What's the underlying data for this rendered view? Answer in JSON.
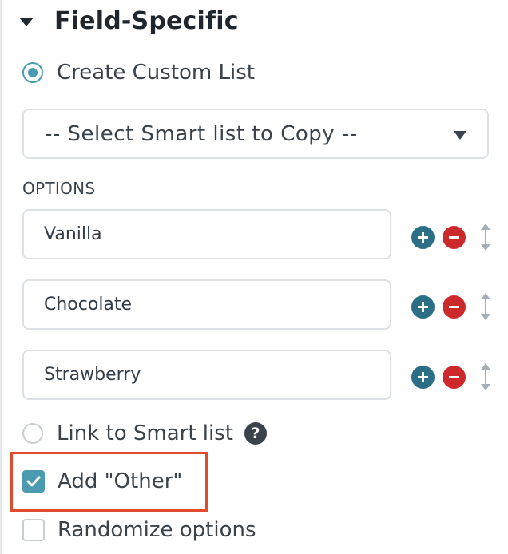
{
  "section": {
    "title": "Field-Specific",
    "caret_icon": "caret-down-icon"
  },
  "source": {
    "custom_list_label": "Create Custom List",
    "custom_list_selected": true,
    "smart_list_select_value": "-- Select Smart list to Copy --"
  },
  "options": {
    "header": "OPTIONS",
    "items": [
      {
        "value": "Vanilla"
      },
      {
        "value": "Chocolate"
      },
      {
        "value": "Strawberry"
      }
    ]
  },
  "settings": {
    "link_smart_list_label": "Link to Smart list",
    "link_smart_list_checked": false,
    "help_glyph": "?",
    "add_other_label": "Add \"Other\"",
    "add_other_checked": true,
    "randomize_label": "Randomize options",
    "randomize_checked": false
  },
  "colors": {
    "accent": "#4a9bb0",
    "add_button": "#2d6e87",
    "remove_button": "#cc2a2a",
    "highlight_border": "#e04a2d"
  }
}
